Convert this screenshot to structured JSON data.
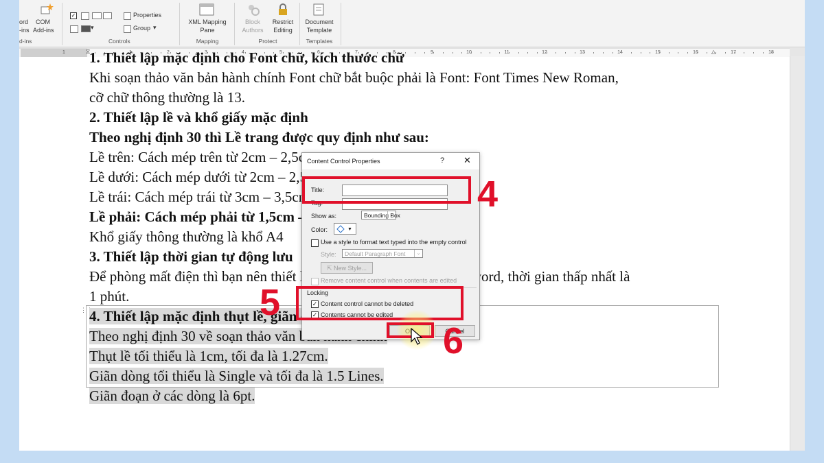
{
  "ribbon": {
    "addins_partial_top": "ord",
    "addins_partial_mid": "-ins",
    "com_label": "COM",
    "com_sub": "Add-ins",
    "addins_group": "d-ins",
    "properties_label": "Properties",
    "group_label": "Group",
    "controls_group": "Controls",
    "xml_label_1": "XML Mapping",
    "xml_label_2": "Pane",
    "mapping_group": "Mapping",
    "block_label_1": "Block",
    "block_label_2": "Authors",
    "restrict_label_1": "Restrict",
    "restrict_label_2": "Editing",
    "protect_group": "Protect",
    "doctemplate_label_1": "Document",
    "doctemplate_label_2": "Template",
    "templates_group": "Templates"
  },
  "ruler": {
    "numbers": [
      "1",
      "1",
      "2",
      "3",
      "4",
      "5",
      "6",
      "7",
      "8",
      "9",
      "10",
      "11",
      "12",
      "13",
      "14",
      "15",
      "16",
      "17",
      "18"
    ]
  },
  "document": {
    "lines": [
      "1. Thiết lập mặc định cho Font chữ, kích thước chữ",
      "Khi soạn thảo văn bản hành chính Font chữ bắt buộc phải là Font: Font Times New Roman,",
      "cỡ chữ thông thường là 13.",
      "2. Thiết lập lề và khổ giấy mặc định",
      "Theo nghị định 30 thì Lề trang được quy định như sau:",
      "Lề trên: Cách mép trên từ 2cm – 2,5cm",
      "Lề dưới: Cách mép dưới từ 2cm – 2,5cm",
      "Lề trái: Cách mép trái từ 3cm – 3,5cm",
      "Lề phải: Cách mép phải từ 1,5cm – 2cm",
      "Khổ giấy thông thường là khổ A4",
      "3. Thiết lập thời gian tự động lưu",
      "Để phòng mất điện thì bạn nên thiết lập thời gian tự động lưu cho word, thời gian thấp nhất là",
      "1 phút.",
      "4. Thiết lập mặc định thụt lề, giãn dòng, giãn đoạn",
      "Theo nghị định 30 về soạn thảo văn bản hành chính",
      "Thụt lề tối thiểu là 1cm, tối đa là 1.27cm.",
      "Giãn dòng tối thiểu là Single và tối đa là 1.5 Lines.",
      "Giãn đoạn ở các dòng là 6pt."
    ]
  },
  "dialog": {
    "title": "Content Control Properties",
    "help": "?",
    "close": "✕",
    "title_label": "Title:",
    "title_value": "",
    "tag_label": "Tag:",
    "tag_value": "",
    "show_as_label": "Show as:",
    "show_as_value": "Bounding Box",
    "color_label": "Color:",
    "use_style_label": "Use a style to format text typed into the empty control",
    "style_label": "Style:",
    "style_value": "Default Paragraph Font",
    "new_style_label": "New Style...",
    "remove_label": "Remove content control when contents are edited",
    "locking_label": "Locking",
    "lock_delete_label": "Content control cannot be deleted",
    "lock_edit_label": "Contents cannot be edited",
    "lock_delete_checked": true,
    "lock_edit_checked": true,
    "ok_label": "OK",
    "cancel_label": "Cancel"
  },
  "annotations": {
    "step_4": "4",
    "step_5": "5",
    "step_6": "6",
    "color": "#e0102a"
  },
  "colors": {
    "background": "#c4dcf4",
    "highlight": "#d9d9d9"
  }
}
